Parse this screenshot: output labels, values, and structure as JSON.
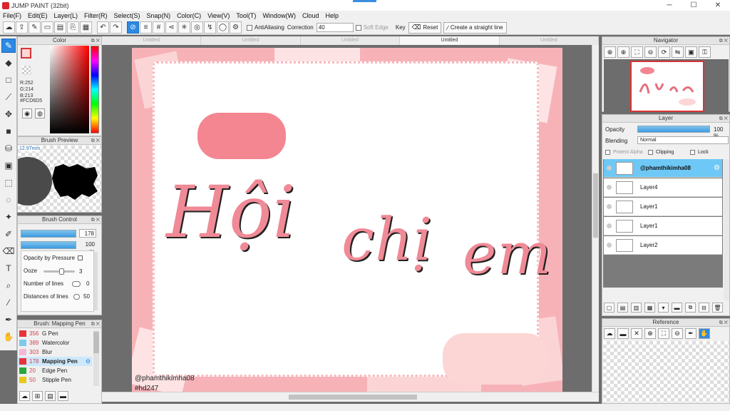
{
  "window": {
    "title": "JUMP PAINT (32bit)",
    "minimize": "─",
    "maximize": "☐",
    "close": "✕"
  },
  "menu": [
    "File(F)",
    "Edit(E)",
    "Layer(L)",
    "Filter(R)",
    "Select(S)",
    "Snap(N)",
    "Color(C)",
    "View(V)",
    "Tool(T)",
    "Window(W)",
    "Cloud",
    "Help"
  ],
  "toolbar": {
    "antialiasing_label": "AntiAliasing",
    "correction_label": "Correction",
    "correction_value": "40",
    "soft_edge_label": "Soft Edge",
    "key_label": "Key",
    "reset_label": "Reset",
    "straight_line_label": "Create a straight line"
  },
  "color_panel": {
    "title": "Color",
    "r": "R:252",
    "g": "G:214",
    "b": "B:213",
    "hex": "#FCD6D5",
    "foreground": "#FCD6D5"
  },
  "brush_preview": {
    "title": "Brush Preview",
    "size": "12.97mm"
  },
  "brush_control": {
    "title": "Brush Control",
    "size_value": "178",
    "opacity_value": "100 %",
    "opacity_by_pressure": "Opacity by Pressure",
    "ooze_label": "Ooze",
    "ooze_value": "3",
    "number_of_lines_label": "Number of lines",
    "number_of_lines_value": "0",
    "distances_label": "Distances of lines",
    "distances_value": "50"
  },
  "brush_list": {
    "title": "Brush: Mapping Pen",
    "items": [
      {
        "num": "356",
        "name": "G Pen",
        "color": "#e8323a"
      },
      {
        "num": "389",
        "name": "Watercolor",
        "color": "#7fc9ee"
      },
      {
        "num": "303",
        "name": "Blur",
        "color": "#f2b9d8"
      },
      {
        "num": "178",
        "name": "Mapping Pen",
        "color": "#e8323a"
      },
      {
        "num": "20",
        "name": "Edge Pen",
        "color": "#2aa63a"
      },
      {
        "num": "50",
        "name": "Stipple Pen",
        "color": "#e8c81a"
      }
    ]
  },
  "tabs": [
    "Untitled",
    "Untitled",
    "Untitled",
    "Untitled",
    "Untitled"
  ],
  "canvas": {
    "word1": "Hội",
    "word2": "chị",
    "word3": "em",
    "watermark1": "@phamthikimha08",
    "watermark2": "#hd247"
  },
  "navigator": {
    "title": "Navigator"
  },
  "layer_panel": {
    "title": "Layer",
    "opacity_label": "Opacity",
    "opacity_value": "100 %",
    "blending_label": "Blending",
    "blending_value": "Normal",
    "protect_alpha": "Protect Alpha",
    "clipping": "Clipping",
    "lock": "Lock",
    "layers": [
      {
        "name": "@phamthikimha08"
      },
      {
        "name": "Layer4"
      },
      {
        "name": "Layer1"
      },
      {
        "name": "Layer1"
      },
      {
        "name": "Layer2"
      }
    ]
  },
  "reference": {
    "title": "Reference"
  }
}
